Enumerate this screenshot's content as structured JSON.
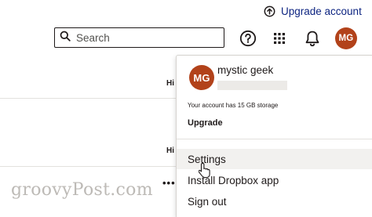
{
  "header": {
    "upgrade_link": "Upgrade account",
    "search_placeholder": "Search",
    "avatar_initials": "MG"
  },
  "rows": {
    "label_1": "Hi",
    "label_2": "Hi",
    "more": "•••"
  },
  "account_menu": {
    "avatar_initials": "MG",
    "user_name": "mystic geek",
    "storage_text": "Your account has 15 GB storage",
    "upgrade_label": "Upgrade",
    "items": [
      {
        "label": "Settings"
      },
      {
        "label": "Install Dropbox app"
      },
      {
        "label": "Sign out"
      }
    ]
  },
  "watermark": "groovyPost.com",
  "colors": {
    "avatar_bg": "#b2421a",
    "link": "#0d2481",
    "hover_bg": "#f2f1ef"
  }
}
